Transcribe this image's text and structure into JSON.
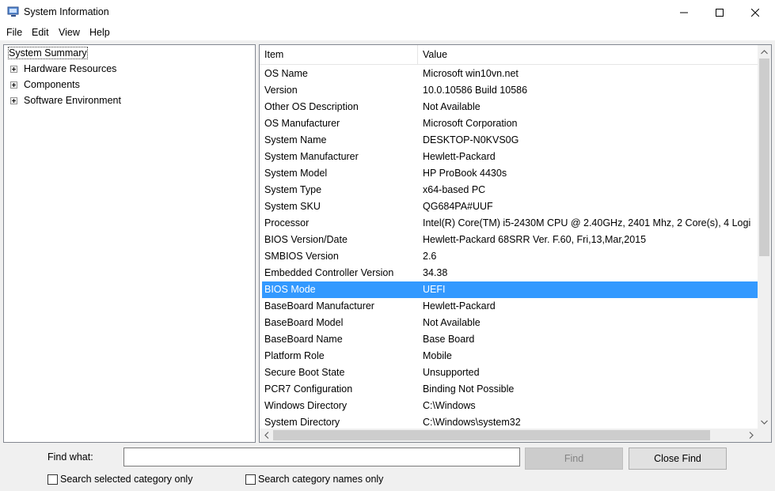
{
  "window": {
    "title": "System Information",
    "icon": "system-information-icon"
  },
  "menu": [
    "File",
    "Edit",
    "View",
    "Help"
  ],
  "tree": {
    "selected": "System Summary",
    "root": "System Summary",
    "children": [
      "Hardware Resources",
      "Components",
      "Software Environment"
    ]
  },
  "list": {
    "columns": {
      "item": "Item",
      "value": "Value"
    },
    "selected_row": "BIOS Mode",
    "rows": [
      {
        "item": "OS Name",
        "value": "Microsoft win10vn.net"
      },
      {
        "item": "Version",
        "value": "10.0.10586 Build 10586"
      },
      {
        "item": "Other OS Description",
        "value": "Not Available"
      },
      {
        "item": "OS Manufacturer",
        "value": "Microsoft Corporation"
      },
      {
        "item": "System Name",
        "value": "DESKTOP-N0KVS0G"
      },
      {
        "item": "System Manufacturer",
        "value": "Hewlett-Packard"
      },
      {
        "item": "System Model",
        "value": "HP ProBook 4430s"
      },
      {
        "item": "System Type",
        "value": "x64-based PC"
      },
      {
        "item": "System SKU",
        "value": "QG684PA#UUF"
      },
      {
        "item": "Processor",
        "value": "Intel(R) Core(TM) i5-2430M CPU @ 2.40GHz, 2401 Mhz, 2 Core(s), 4 Logi"
      },
      {
        "item": "BIOS Version/Date",
        "value": "Hewlett-Packard 68SRR Ver. F.60, Fri,13,Mar,2015"
      },
      {
        "item": "SMBIOS Version",
        "value": "2.6"
      },
      {
        "item": "Embedded Controller Version",
        "value": "34.38"
      },
      {
        "item": "BIOS Mode",
        "value": "UEFI"
      },
      {
        "item": "BaseBoard Manufacturer",
        "value": "Hewlett-Packard"
      },
      {
        "item": "BaseBoard Model",
        "value": "Not Available"
      },
      {
        "item": "BaseBoard Name",
        "value": "Base Board"
      },
      {
        "item": "Platform Role",
        "value": "Mobile"
      },
      {
        "item": "Secure Boot State",
        "value": "Unsupported"
      },
      {
        "item": "PCR7 Configuration",
        "value": "Binding Not Possible"
      },
      {
        "item": "Windows Directory",
        "value": "C:\\Windows"
      },
      {
        "item": "System Directory",
        "value": "C:\\Windows\\system32"
      }
    ]
  },
  "find": {
    "label": "Find what:",
    "value": "",
    "find_button": "Find",
    "close_button": "Close Find",
    "check_selected": "Search selected category only",
    "check_names": "Search category names only"
  },
  "colors": {
    "selection": "#3399ff",
    "window_bg": "#f0f0f0"
  }
}
